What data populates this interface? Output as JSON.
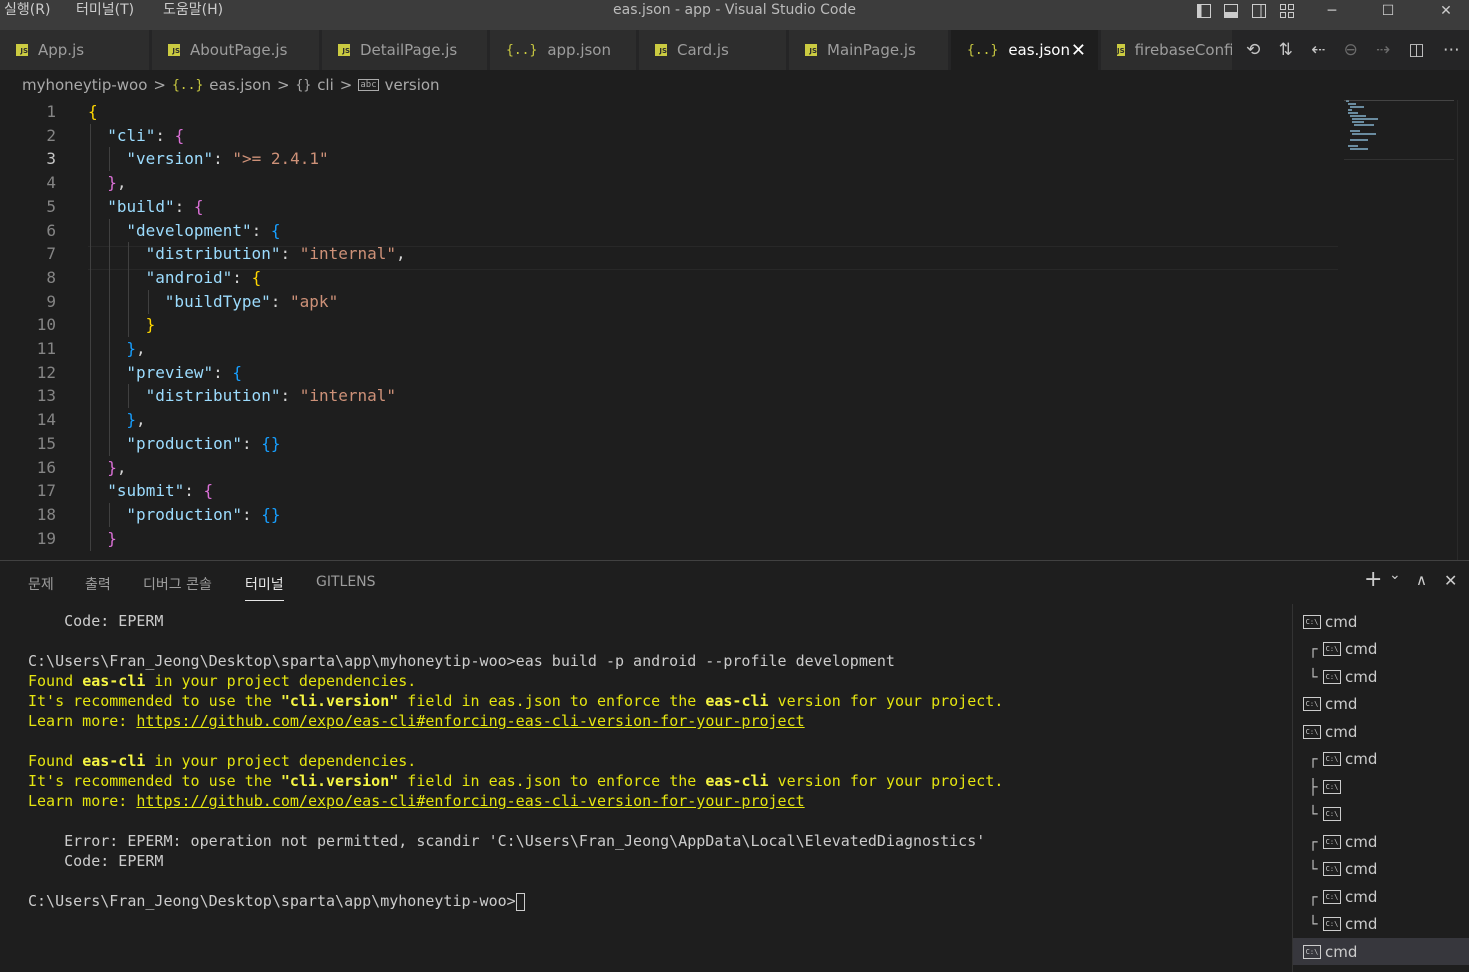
{
  "titlebar": {
    "menus": [
      "실행(R)",
      "터미널(T)",
      "도움말(H)"
    ],
    "title": "eas.json - app - Visual Studio Code",
    "minimize": "─",
    "maximize": "☐",
    "close": "✕"
  },
  "tabs": [
    {
      "label": "App.js",
      "icon": "js-icon"
    },
    {
      "label": "AboutPage.js",
      "icon": "js-icon"
    },
    {
      "label": "DetailPage.js",
      "icon": "js-icon"
    },
    {
      "label": "app.json",
      "icon": "json-icon"
    },
    {
      "label": "Card.js",
      "icon": "js-icon"
    },
    {
      "label": "MainPage.js",
      "icon": "js-icon"
    },
    {
      "label": "eas.json",
      "icon": "json-icon",
      "active": true
    },
    {
      "label": "firebaseConfi",
      "icon": "js-icon"
    }
  ],
  "icon_glyphs": {
    "js": "JS",
    "json": "{..}",
    "braces": "{}",
    "abc": "abc",
    "cmd": "C:\\",
    "close": "✕"
  },
  "breadcrumb": {
    "folder": "myhoneytip-woo",
    "file": "eas.json",
    "object": "cli",
    "property": "version",
    "sep": ">"
  },
  "editor": {
    "current_line": 3,
    "line_numbers": [
      "1",
      "2",
      "3",
      "4",
      "5",
      "6",
      "7",
      "8",
      "9",
      "10",
      "11",
      "12",
      "13",
      "14",
      "15",
      "16",
      "17",
      "18",
      "19"
    ],
    "lines": [
      {
        "indent": 0,
        "tokens": [
          {
            "t": "{",
            "c": "b1"
          }
        ]
      },
      {
        "indent": 1,
        "tokens": [
          {
            "t": "\"cli\"",
            "c": "k"
          },
          {
            "t": ": ",
            "c": "p"
          },
          {
            "t": "{",
            "c": "b2"
          }
        ]
      },
      {
        "indent": 2,
        "tokens": [
          {
            "t": "\"version\"",
            "c": "k"
          },
          {
            "t": ": ",
            "c": "p"
          },
          {
            "t": "\">= 2.4.1\"",
            "c": "s"
          }
        ]
      },
      {
        "indent": 1,
        "tokens": [
          {
            "t": "}",
            "c": "b2"
          },
          {
            "t": ",",
            "c": "p"
          }
        ]
      },
      {
        "indent": 1,
        "tokens": [
          {
            "t": "\"build\"",
            "c": "k"
          },
          {
            "t": ": ",
            "c": "p"
          },
          {
            "t": "{",
            "c": "b2"
          }
        ]
      },
      {
        "indent": 2,
        "tokens": [
          {
            "t": "\"development\"",
            "c": "k"
          },
          {
            "t": ": ",
            "c": "p"
          },
          {
            "t": "{",
            "c": "b3"
          }
        ]
      },
      {
        "indent": 3,
        "tokens": [
          {
            "t": "\"distribution\"",
            "c": "k"
          },
          {
            "t": ": ",
            "c": "p"
          },
          {
            "t": "\"internal\"",
            "c": "s"
          },
          {
            "t": ",",
            "c": "p"
          }
        ]
      },
      {
        "indent": 3,
        "tokens": [
          {
            "t": "\"android\"",
            "c": "k"
          },
          {
            "t": ": ",
            "c": "p"
          },
          {
            "t": "{",
            "c": "b1"
          }
        ]
      },
      {
        "indent": 4,
        "tokens": [
          {
            "t": "\"buildType\"",
            "c": "k"
          },
          {
            "t": ": ",
            "c": "p"
          },
          {
            "t": "\"apk\"",
            "c": "s"
          }
        ]
      },
      {
        "indent": 3,
        "tokens": [
          {
            "t": "}",
            "c": "b1"
          }
        ]
      },
      {
        "indent": 2,
        "tokens": [
          {
            "t": "}",
            "c": "b3"
          },
          {
            "t": ",",
            "c": "p"
          }
        ]
      },
      {
        "indent": 2,
        "tokens": [
          {
            "t": "\"preview\"",
            "c": "k"
          },
          {
            "t": ": ",
            "c": "p"
          },
          {
            "t": "{",
            "c": "b3"
          }
        ]
      },
      {
        "indent": 3,
        "tokens": [
          {
            "t": "\"distribution\"",
            "c": "k"
          },
          {
            "t": ": ",
            "c": "p"
          },
          {
            "t": "\"internal\"",
            "c": "s"
          }
        ]
      },
      {
        "indent": 2,
        "tokens": [
          {
            "t": "}",
            "c": "b3"
          },
          {
            "t": ",",
            "c": "p"
          }
        ]
      },
      {
        "indent": 2,
        "tokens": [
          {
            "t": "\"production\"",
            "c": "k"
          },
          {
            "t": ": ",
            "c": "p"
          },
          {
            "t": "{}",
            "c": "b3"
          }
        ]
      },
      {
        "indent": 1,
        "tokens": [
          {
            "t": "}",
            "c": "b2"
          },
          {
            "t": ",",
            "c": "p"
          }
        ]
      },
      {
        "indent": 1,
        "tokens": [
          {
            "t": "\"submit\"",
            "c": "k"
          },
          {
            "t": ": ",
            "c": "p"
          },
          {
            "t": "{",
            "c": "b2"
          }
        ]
      },
      {
        "indent": 2,
        "tokens": [
          {
            "t": "\"production\"",
            "c": "k"
          },
          {
            "t": ": ",
            "c": "p"
          },
          {
            "t": "{}",
            "c": "b3"
          }
        ]
      },
      {
        "indent": 1,
        "tokens": [
          {
            "t": "}",
            "c": "b2"
          }
        ]
      }
    ]
  },
  "panel": {
    "tabs": [
      "문제",
      "출력",
      "디버그 콘솔",
      "터미널",
      "GITLENS"
    ],
    "active_tab": "터미널",
    "actions": {
      "add": "+",
      "dropdown": "⌄",
      "maximize": "∧",
      "close": "✕"
    }
  },
  "terminal": {
    "lines": [
      [
        {
          "t": "    Code: EPERM",
          "c": ""
        }
      ],
      [
        {
          "t": "",
          "c": ""
        }
      ],
      [
        {
          "t": "C:\\Users\\Fran_Jeong\\Desktop\\sparta\\app\\myhoneytip-woo>eas build -p android --profile development",
          "c": ""
        }
      ],
      [
        {
          "t": "Found ",
          "c": "y"
        },
        {
          "t": "eas-cli",
          "c": "yb"
        },
        {
          "t": " in your project dependencies.",
          "c": "y"
        }
      ],
      [
        {
          "t": "It's recommended to use the ",
          "c": "y"
        },
        {
          "t": "\"cli.version\"",
          "c": "yb"
        },
        {
          "t": " field in eas.json to enforce the ",
          "c": "y"
        },
        {
          "t": "eas-cli",
          "c": "yb"
        },
        {
          "t": " version for your project.",
          "c": "y"
        }
      ],
      [
        {
          "t": "Learn more: ",
          "c": "y"
        },
        {
          "t": "https://github.com/expo/eas-cli#enforcing-eas-cli-version-for-your-project",
          "c": "yl"
        }
      ],
      [
        {
          "t": "",
          "c": ""
        }
      ],
      [
        {
          "t": "Found ",
          "c": "y"
        },
        {
          "t": "eas-cli",
          "c": "yb"
        },
        {
          "t": " in your project dependencies.",
          "c": "y"
        }
      ],
      [
        {
          "t": "It's recommended to use the ",
          "c": "y"
        },
        {
          "t": "\"cli.version\"",
          "c": "yb"
        },
        {
          "t": " field in eas.json to enforce the ",
          "c": "y"
        },
        {
          "t": "eas-cli",
          "c": "yb"
        },
        {
          "t": " version for your project.",
          "c": "y"
        }
      ],
      [
        {
          "t": "Learn more: ",
          "c": "y"
        },
        {
          "t": "https://github.com/expo/eas-cli#enforcing-eas-cli-version-for-your-project",
          "c": "yl"
        }
      ],
      [
        {
          "t": "",
          "c": ""
        }
      ],
      [
        {
          "t": "    Error: EPERM: operation not permitted, scandir 'C:\\Users\\Fran_Jeong\\AppData\\Local\\ElevatedDiagnostics'",
          "c": ""
        }
      ],
      [
        {
          "t": "    Code: EPERM",
          "c": ""
        }
      ],
      [
        {
          "t": "",
          "c": ""
        }
      ],
      [
        {
          "t": "C:\\Users\\Fran_Jeong\\Desktop\\sparta\\app\\myhoneytip-woo>",
          "c": ""
        }
      ]
    ]
  },
  "terminal_list": [
    {
      "tree": "",
      "label": "cmd"
    },
    {
      "tree": "┌",
      "label": "cmd"
    },
    {
      "tree": "└",
      "label": "cmd"
    },
    {
      "tree": "",
      "label": "cmd"
    },
    {
      "tree": "",
      "label": "cmd"
    },
    {
      "tree": "┌",
      "label": "cmd"
    },
    {
      "tree": "├",
      "label": ""
    },
    {
      "tree": "└",
      "label": ""
    },
    {
      "tree": "┌",
      "label": "cmd"
    },
    {
      "tree": "└",
      "label": "cmd"
    },
    {
      "tree": "┌",
      "label": "cmd"
    },
    {
      "tree": "└",
      "label": "cmd"
    },
    {
      "tree": "",
      "label": "cmd",
      "selected": true
    }
  ]
}
